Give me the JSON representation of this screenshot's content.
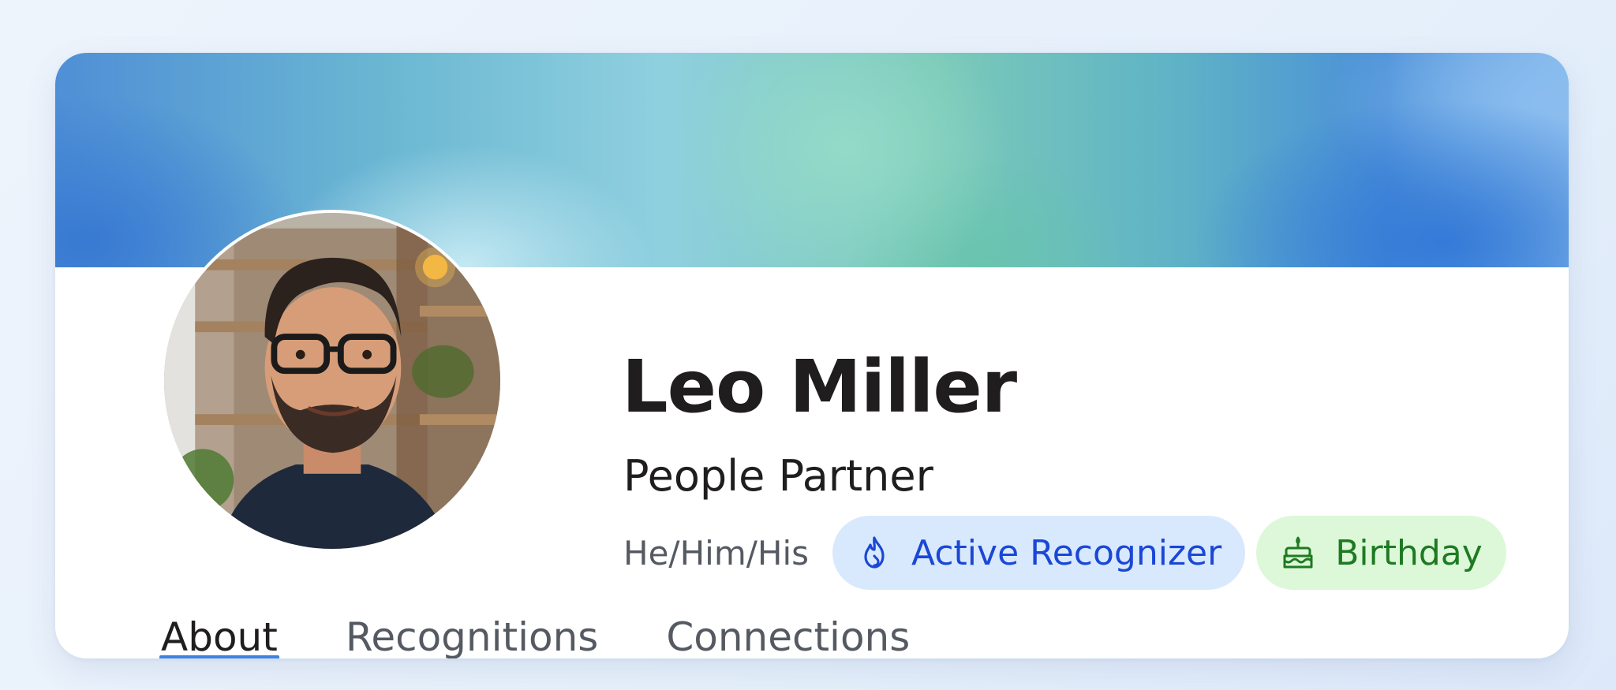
{
  "profile": {
    "name": "Leo Miller",
    "job_title": "People Partner",
    "pronouns": "He/Him/His",
    "avatar_alt": "Leo Miller"
  },
  "badges": [
    {
      "label": "Active Recognizer",
      "icon": "flame-icon",
      "color": "#1a47d6",
      "background": "#d9e9fd"
    },
    {
      "label": "Birthday",
      "icon": "cake-icon",
      "color": "#1e7a22",
      "background": "#ddf8d8"
    }
  ],
  "tabs": [
    {
      "label": "About",
      "active": true
    },
    {
      "label": "Recognitions",
      "active": false
    },
    {
      "label": "Connections",
      "active": false
    }
  ],
  "colors": {
    "accent": "#3d82e6",
    "text_primary": "#1f1d1d",
    "text_secondary": "#555a62"
  }
}
